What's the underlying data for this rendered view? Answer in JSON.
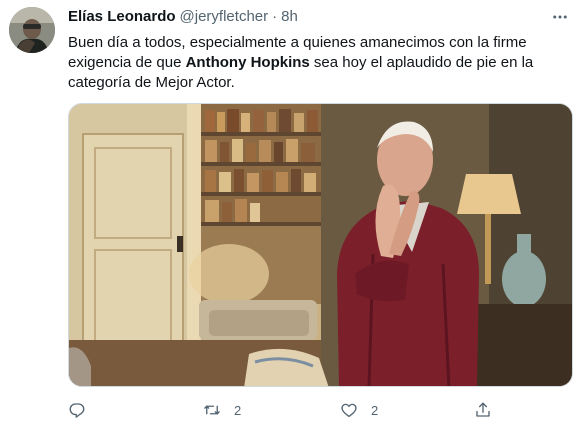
{
  "tweet": {
    "author_name": "Elías Leonardo",
    "handle": "@jeryfletcher",
    "separator": "·",
    "time": "8h",
    "text_before": "Buen día a todos, especialmente a quienes amanecimos con la firme exigencia de que ",
    "text_bold": "Anthony Hopkins",
    "text_after": " sea hoy el aplaudido de pie en la categoría de Mejor Actor."
  },
  "actions": {
    "retweet_count": "2",
    "like_count": "2"
  },
  "icons": {
    "more": "more-horizontal-icon",
    "reply": "reply-icon",
    "retweet": "retweet-icon",
    "like": "heart-icon",
    "share": "share-icon"
  },
  "colors": {
    "text": "#0f1419",
    "secondary": "#536471"
  }
}
